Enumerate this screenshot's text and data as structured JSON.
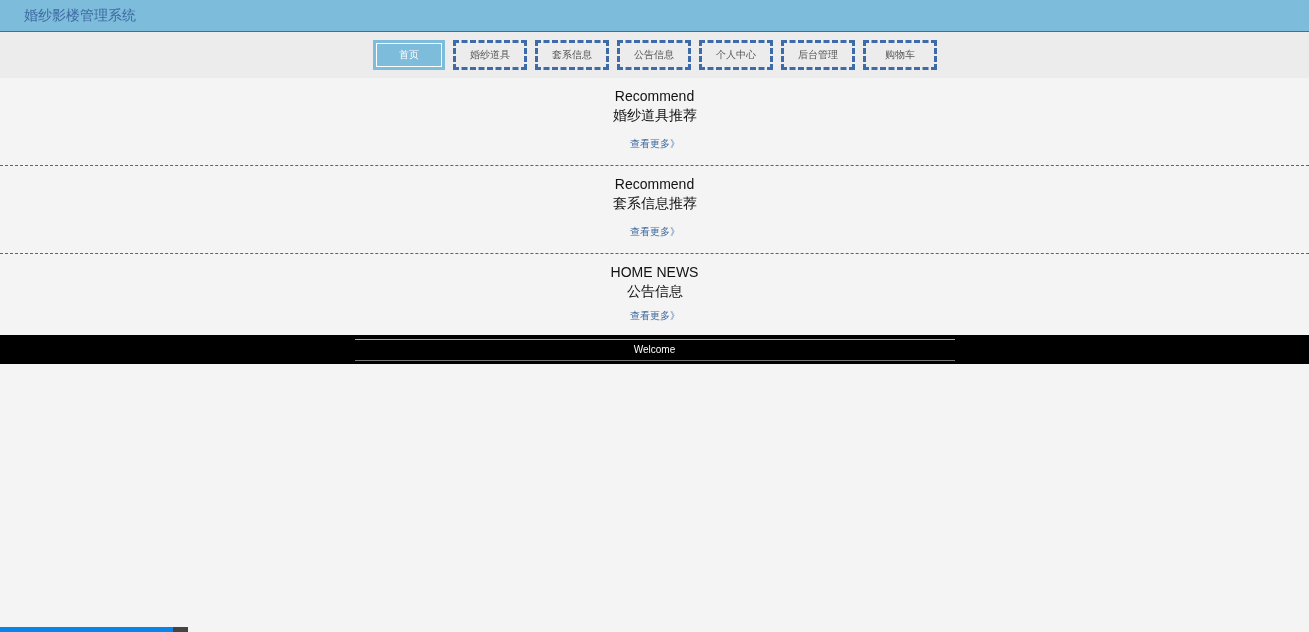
{
  "header": {
    "title": "婚纱影楼管理系统"
  },
  "nav": [
    {
      "label": "首页",
      "selected": true
    },
    {
      "label": "婚纱道具",
      "selected": false
    },
    {
      "label": "套系信息",
      "selected": false
    },
    {
      "label": "公告信息",
      "selected": false
    },
    {
      "label": "个人中心",
      "selected": false
    },
    {
      "label": "后台管理",
      "selected": false
    },
    {
      "label": "购物车",
      "selected": false
    }
  ],
  "sections": [
    {
      "subtitle": "Recommend",
      "title": "婚纱道具推荐",
      "more": "查看更多》"
    },
    {
      "subtitle": "Recommend",
      "title": "套系信息推荐",
      "more": "查看更多》"
    },
    {
      "subtitle": "HOME NEWS",
      "title": "公告信息",
      "more": "查看更多》"
    }
  ],
  "footer": {
    "text": "Welcome"
  },
  "player": {
    "level": 0.92
  }
}
